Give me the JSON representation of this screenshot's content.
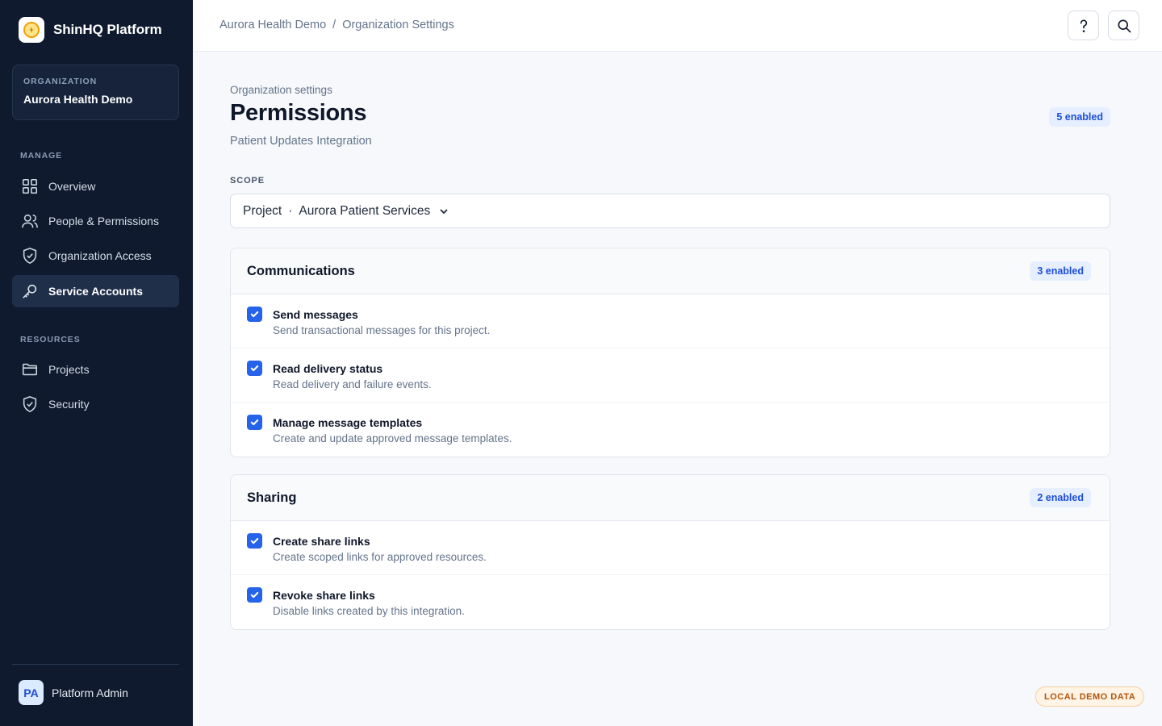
{
  "app": {
    "name": "ShinHQ Platform"
  },
  "organization": {
    "label": "ORGANIZATION",
    "name": "Aurora Health Demo"
  },
  "sidebar": {
    "manage_label": "MANAGE",
    "manage_items": [
      {
        "label": "Overview",
        "icon": "grid-icon"
      },
      {
        "label": "People & Permissions",
        "icon": "users-icon"
      },
      {
        "label": "Organization Access",
        "icon": "shield-icon"
      },
      {
        "label": "Service Accounts",
        "icon": "key-icon",
        "active": true
      }
    ],
    "resources_label": "RESOURCES",
    "resources_items": [
      {
        "label": "Projects",
        "icon": "folder-icon"
      },
      {
        "label": "Security",
        "icon": "shield-icon"
      }
    ]
  },
  "user": {
    "initials": "PA",
    "name": "Platform Admin"
  },
  "breadcrumb": {
    "root": "Aurora Health Demo",
    "separator": "/",
    "current": "Organization Settings"
  },
  "header_buttons": {
    "help_icon": "help-icon",
    "search_icon": "search-icon"
  },
  "page": {
    "eyebrow": "Organization settings",
    "title": "Permissions",
    "subtitle": "Patient Updates Integration",
    "enabled_badge": "5 enabled"
  },
  "scope": {
    "label": "SCOPE",
    "type": "Project",
    "dot": "·",
    "value": "Aurora Patient Services"
  },
  "groups": [
    {
      "title": "Communications",
      "badge": "3 enabled",
      "permissions": [
        {
          "name": "Send messages",
          "description": "Send transactional messages for this project.",
          "checked": true
        },
        {
          "name": "Read delivery status",
          "description": "Read delivery and failure events.",
          "checked": true
        },
        {
          "name": "Manage message templates",
          "description": "Create and update approved message templates.",
          "checked": true
        }
      ]
    },
    {
      "title": "Sharing",
      "badge": "2 enabled",
      "permissions": [
        {
          "name": "Create share links",
          "description": "Create scoped links for approved resources.",
          "checked": true
        },
        {
          "name": "Revoke share links",
          "description": "Disable links created by this integration.",
          "checked": true
        }
      ]
    }
  ],
  "footer_tag": "LOCAL DEMO DATA",
  "colors": {
    "sidebar": "#0f1a2e",
    "accent": "#2563eb",
    "badge_bg": "#e6efff",
    "demo_tag": "#b45309"
  }
}
